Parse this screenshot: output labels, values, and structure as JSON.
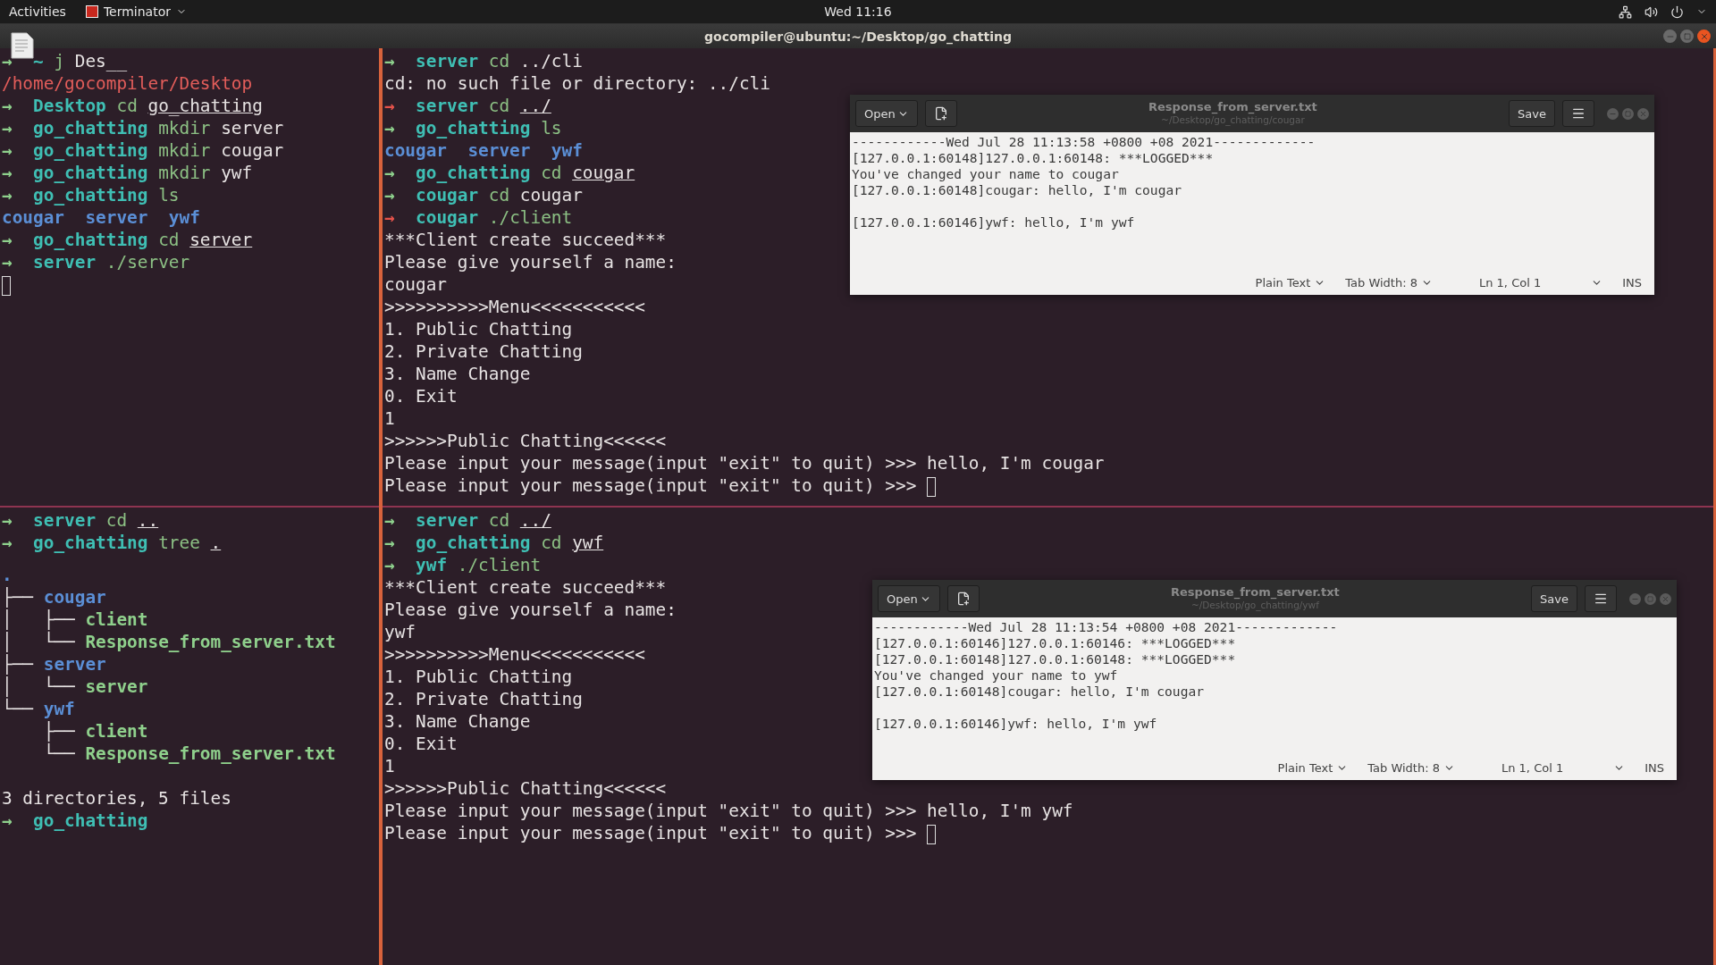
{
  "top_bar": {
    "activities": "Activities",
    "app_menu": "Terminator",
    "clock": "Wed 11:16"
  },
  "window": {
    "title": "gocompiler@ubuntu:~/Desktop/go_chatting"
  },
  "panes": [
    {
      "blocks": [
        [
          [
            {
              "kind": "arrow",
              "text": "→ "
            },
            {
              "kind": "dir",
              "text": "~ "
            },
            {
              "kind": "cmd",
              "text": "j "
            },
            {
              "kind": "arg",
              "text": "Des__"
            }
          ],
          [
            {
              "kind": "path",
              "text": "/home/gocompiler/Desktop"
            }
          ],
          [
            {
              "kind": "arrow",
              "text": "→ "
            },
            {
              "kind": "dir",
              "text": "Desktop "
            },
            {
              "kind": "cmd",
              "text": "cd "
            },
            {
              "kind": "link",
              "text": "go_chatting"
            }
          ],
          [
            {
              "kind": "arrow",
              "text": "→ "
            },
            {
              "kind": "dir",
              "text": "go_chatting "
            },
            {
              "kind": "cmd",
              "text": "mkdir "
            },
            {
              "kind": "arg",
              "text": "server"
            }
          ],
          [
            {
              "kind": "arrow",
              "text": "→ "
            },
            {
              "kind": "dir",
              "text": "go_chatting "
            },
            {
              "kind": "cmd",
              "text": "mkdir "
            },
            {
              "kind": "arg",
              "text": "cougar"
            }
          ],
          [
            {
              "kind": "arrow",
              "text": "→ "
            },
            {
              "kind": "dir",
              "text": "go_chatting "
            },
            {
              "kind": "cmd",
              "text": "mkdir "
            },
            {
              "kind": "arg",
              "text": "ywf"
            }
          ],
          [
            {
              "kind": "arrow",
              "text": "→ "
            },
            {
              "kind": "dir",
              "text": "go_chatting "
            },
            {
              "kind": "cmd",
              "text": "ls"
            }
          ],
          [
            {
              "kind": "lsdir",
              "text": "cougar  server  ywf"
            }
          ],
          [
            {
              "kind": "arrow",
              "text": "→ "
            },
            {
              "kind": "dir",
              "text": "go_chatting "
            },
            {
              "kind": "cmd",
              "text": "cd "
            },
            {
              "kind": "link",
              "text": "server"
            }
          ],
          [
            {
              "kind": "arrow",
              "text": "→ "
            },
            {
              "kind": "dir",
              "text": "server "
            },
            {
              "kind": "cmd",
              "text": "./server"
            }
          ],
          [
            {
              "kind": "cursor"
            }
          ]
        ]
      ]
    },
    {
      "blocks": [
        [
          [
            {
              "kind": "arrow",
              "text": "→ "
            },
            {
              "kind": "dir",
              "text": "server "
            },
            {
              "kind": "cmd",
              "text": "cd "
            },
            {
              "kind": "arg",
              "text": "../cli"
            }
          ],
          [
            {
              "kind": "out",
              "text": "cd: no such file or directory: ../cli"
            }
          ],
          [
            {
              "kind": "arrow_err",
              "text": "→ "
            },
            {
              "kind": "dir",
              "text": "server "
            },
            {
              "kind": "cmd",
              "text": "cd "
            },
            {
              "kind": "link",
              "text": "../"
            }
          ],
          [
            {
              "kind": "arrow",
              "text": "→ "
            },
            {
              "kind": "dir",
              "text": "go_chatting "
            },
            {
              "kind": "cmd",
              "text": "ls"
            }
          ],
          [
            {
              "kind": "lsdir",
              "text": "cougar  server  ywf"
            }
          ],
          [
            {
              "kind": "arrow",
              "text": "→ "
            },
            {
              "kind": "dir",
              "text": "go_chatting "
            },
            {
              "kind": "cmd",
              "text": "cd "
            },
            {
              "kind": "link",
              "text": "cougar"
            }
          ],
          [
            {
              "kind": "arrow",
              "text": "→ "
            },
            {
              "kind": "dir",
              "text": "cougar "
            },
            {
              "kind": "cmd",
              "text": "cd "
            },
            {
              "kind": "arg",
              "text": "cougar"
            }
          ],
          [
            {
              "kind": "arrow_err",
              "text": "→ "
            },
            {
              "kind": "dir",
              "text": "cougar "
            },
            {
              "kind": "cmd",
              "text": "./client"
            }
          ],
          [
            {
              "kind": "out",
              "text": "***Client create succeed***"
            }
          ],
          [
            {
              "kind": "out",
              "text": "Please give yourself a name:"
            }
          ],
          [
            {
              "kind": "out",
              "text": "cougar"
            }
          ],
          [
            {
              "kind": "out",
              "text": ">>>>>>>>>>Menu<<<<<<<<<<<"
            }
          ],
          [
            {
              "kind": "out",
              "text": "1. Public Chatting"
            }
          ],
          [
            {
              "kind": "out",
              "text": "2. Private Chatting"
            }
          ],
          [
            {
              "kind": "out",
              "text": "3. Name Change"
            }
          ],
          [
            {
              "kind": "out",
              "text": "0. Exit"
            }
          ],
          [
            {
              "kind": "out",
              "text": "1"
            }
          ],
          [
            {
              "kind": "out",
              "text": ">>>>>>Public Chatting<<<<<<"
            }
          ],
          [
            {
              "kind": "out",
              "text": "Please input your message(input \"exit\" to quit) >>> hello, I'm cougar"
            }
          ],
          [
            {
              "kind": "out",
              "text": "Please input your message(input \"exit\" to quit) >>> "
            },
            {
              "kind": "cursor"
            }
          ]
        ]
      ]
    },
    {
      "blocks": [
        [
          [
            {
              "kind": "arrow",
              "text": "→ "
            },
            {
              "kind": "dir",
              "text": "server "
            },
            {
              "kind": "cmd",
              "text": "cd "
            },
            {
              "kind": "link",
              "text": ".."
            }
          ],
          [
            {
              "kind": "arrow",
              "text": "→ "
            },
            {
              "kind": "dir",
              "text": "go_chatting "
            },
            {
              "kind": "cmd",
              "text": "tree "
            },
            {
              "kind": "link",
              "text": "."
            }
          ]
        ],
        [
          [
            {
              "kind": "lsdir",
              "text": "."
            }
          ],
          [
            {
              "kind": "tree",
              "text": "├── "
            },
            {
              "kind": "lsdir",
              "text": "cougar"
            }
          ],
          [
            {
              "kind": "tree",
              "text": "│   ├── "
            },
            {
              "kind": "exe",
              "text": "client"
            }
          ],
          [
            {
              "kind": "tree",
              "text": "│   └── "
            },
            {
              "kind": "exe",
              "text": "Response_from_server.txt"
            }
          ],
          [
            {
              "kind": "tree",
              "text": "├── "
            },
            {
              "kind": "lsdir",
              "text": "server"
            }
          ],
          [
            {
              "kind": "tree",
              "text": "│   └── "
            },
            {
              "kind": "exe",
              "text": "server"
            }
          ],
          [
            {
              "kind": "tree",
              "text": "└── "
            },
            {
              "kind": "lsdir",
              "text": "ywf"
            }
          ],
          [
            {
              "kind": "tree",
              "text": "    ├── "
            },
            {
              "kind": "exe",
              "text": "client"
            }
          ],
          [
            {
              "kind": "tree",
              "text": "    └── "
            },
            {
              "kind": "exe",
              "text": "Response_from_server.txt"
            }
          ]
        ],
        [
          [
            {
              "kind": "out",
              "text": "3 directories, 5 files"
            }
          ],
          [
            {
              "kind": "arrow",
              "text": "→ "
            },
            {
              "kind": "dir",
              "text": "go_chatting"
            }
          ]
        ]
      ]
    },
    {
      "blocks": [
        [
          [
            {
              "kind": "arrow",
              "text": "→ "
            },
            {
              "kind": "dir",
              "text": "server "
            },
            {
              "kind": "cmd",
              "text": "cd "
            },
            {
              "kind": "link",
              "text": "../"
            }
          ],
          [
            {
              "kind": "arrow",
              "text": "→ "
            },
            {
              "kind": "dir",
              "text": "go_chatting "
            },
            {
              "kind": "cmd",
              "text": "cd "
            },
            {
              "kind": "link",
              "text": "ywf"
            }
          ],
          [
            {
              "kind": "arrow",
              "text": "→ "
            },
            {
              "kind": "dir",
              "text": "ywf "
            },
            {
              "kind": "cmd",
              "text": "./client"
            }
          ],
          [
            {
              "kind": "out",
              "text": "***Client create succeed***"
            }
          ],
          [
            {
              "kind": "out",
              "text": "Please give yourself a name:"
            }
          ],
          [
            {
              "kind": "out",
              "text": "ywf"
            }
          ],
          [
            {
              "kind": "out",
              "text": ">>>>>>>>>>Menu<<<<<<<<<<<"
            }
          ],
          [
            {
              "kind": "out",
              "text": "1. Public Chatting"
            }
          ],
          [
            {
              "kind": "out",
              "text": "2. Private Chatting"
            }
          ],
          [
            {
              "kind": "out",
              "text": "3. Name Change"
            }
          ],
          [
            {
              "kind": "out",
              "text": "0. Exit"
            }
          ],
          [
            {
              "kind": "out",
              "text": "1"
            }
          ],
          [
            {
              "kind": "out",
              "text": ">>>>>>Public Chatting<<<<<<"
            }
          ],
          [
            {
              "kind": "out",
              "text": "Please input your message(input \"exit\" to quit) >>> hello, I'm ywf"
            }
          ],
          [
            {
              "kind": "out",
              "text": "Please input your message(input \"exit\" to quit) >>> "
            },
            {
              "kind": "cursor"
            }
          ]
        ]
      ]
    }
  ],
  "editors": [
    {
      "open": "Open",
      "title": "Response_from_server.txt",
      "path": "~/Desktop/go_chatting/cougar",
      "save": "Save",
      "blocks": [
        [
          "------------Wed Jul 28 11:13:58 +0800 +08 2021-------------",
          "[127.0.0.1:60148]127.0.0.1:60148: ***LOGGED***",
          "You've changed your name to cougar",
          "[127.0.0.1:60148]cougar: hello, I'm cougar"
        ],
        [
          "[127.0.0.1:60146]ywf: hello, I'm ywf"
        ]
      ],
      "status": {
        "language": "Plain Text",
        "tab_width": "Tab Width: 8",
        "position": "Ln 1, Col 1",
        "mode": "INS"
      }
    },
    {
      "open": "Open",
      "title": "Response_from_server.txt",
      "path": "~/Desktop/go_chatting/ywf",
      "save": "Save",
      "blocks": [
        [
          "------------Wed Jul 28 11:13:54 +0800 +08 2021-------------",
          "[127.0.0.1:60146]127.0.0.1:60146: ***LOGGED***",
          "[127.0.0.1:60148]127.0.0.1:60148: ***LOGGED***",
          "You've changed your name to ywf",
          "[127.0.0.1:60148]cougar: hello, I'm cougar"
        ],
        [
          "[127.0.0.1:60146]ywf: hello, I'm ywf"
        ]
      ],
      "status": {
        "language": "Plain Text",
        "tab_width": "Tab Width: 8",
        "position": "Ln 1, Col 1",
        "mode": "INS"
      }
    }
  ]
}
